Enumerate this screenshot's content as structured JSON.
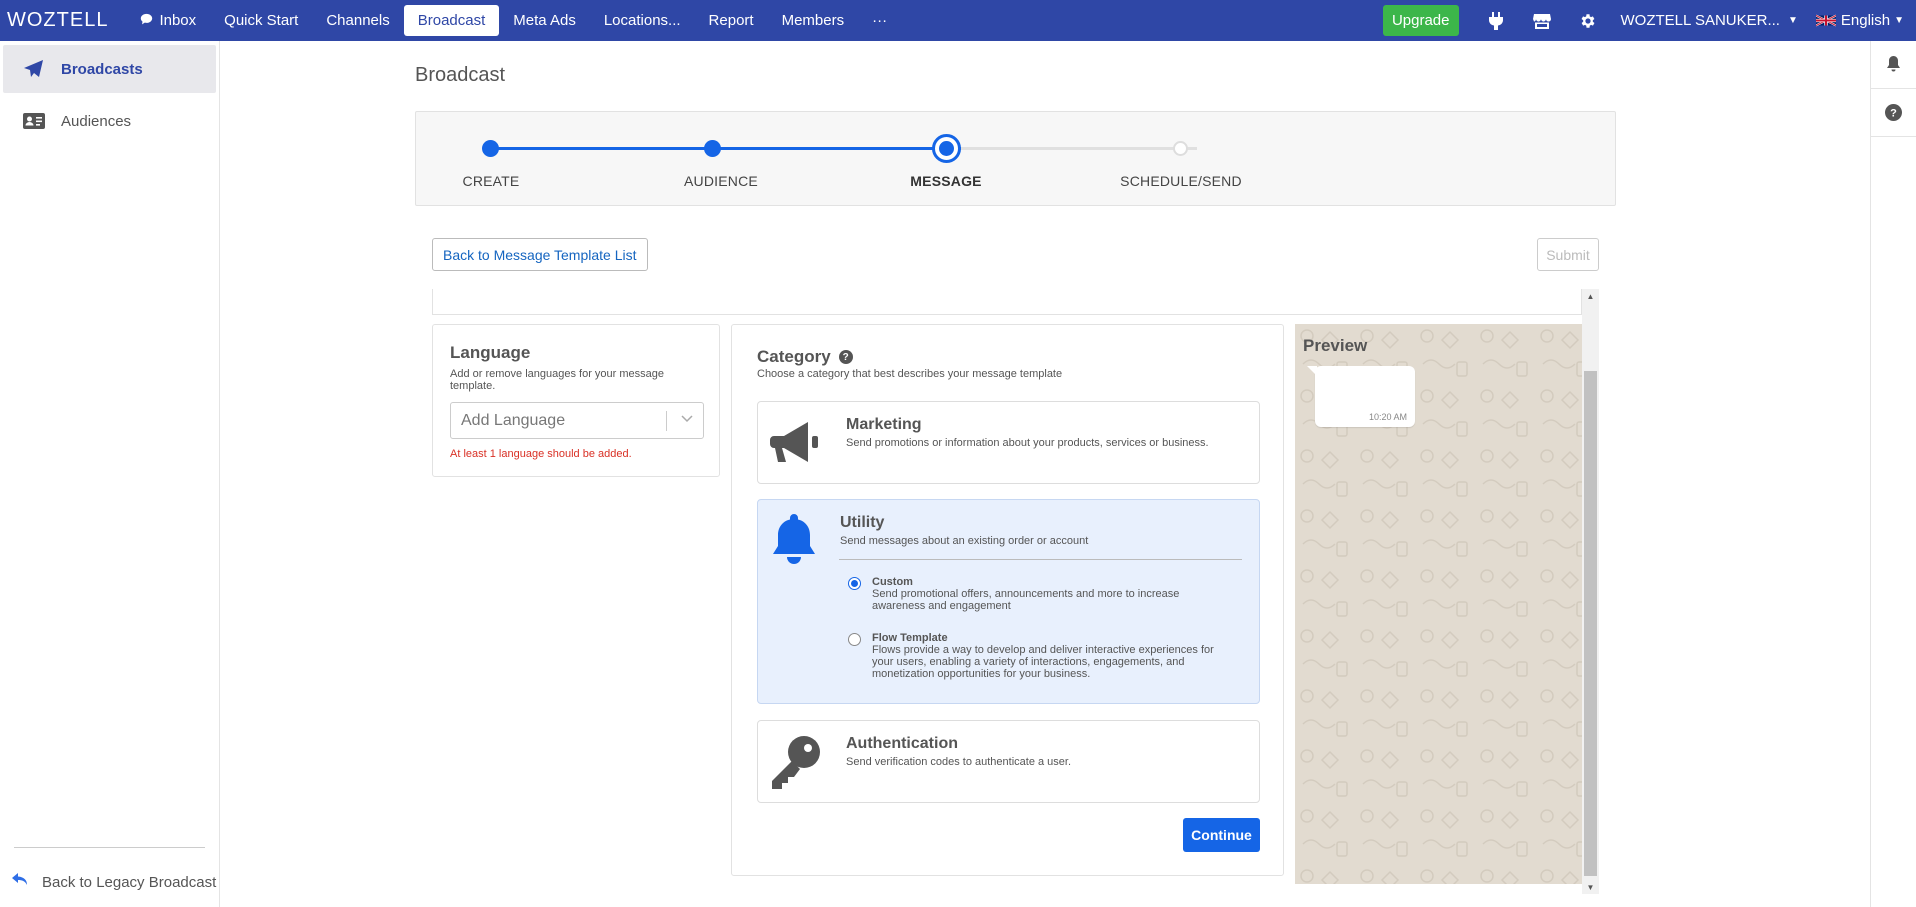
{
  "nav": {
    "logo": "WOZTELL",
    "items": [
      {
        "label": "Inbox",
        "icon": "chat-bubble-icon"
      },
      {
        "label": "Quick Start"
      },
      {
        "label": "Channels"
      },
      {
        "label": "Broadcast",
        "active": true
      },
      {
        "label": "Meta Ads"
      },
      {
        "label": "Locations..."
      },
      {
        "label": "Report"
      },
      {
        "label": "Members"
      },
      {
        "label": "···"
      }
    ],
    "upgrade": "Upgrade",
    "account": "WOZTELL SANUKER...",
    "language": "English",
    "colors": {
      "bar": "#2f47a6",
      "upgrade": "#3cb64a"
    }
  },
  "sidebar": {
    "items": [
      {
        "label": "Broadcasts",
        "icon": "paper-plane-icon",
        "active": true
      },
      {
        "label": "Audiences",
        "icon": "id-card-icon"
      }
    ],
    "legacy": "Back to Legacy Broadcast"
  },
  "page": {
    "title": "Broadcast"
  },
  "stepper": {
    "steps": [
      "CREATE",
      "AUDIENCE",
      "MESSAGE",
      "SCHEDULE/SEND"
    ],
    "current_index": 2
  },
  "buttons": {
    "back": "Back to Message Template List",
    "submit": "Submit",
    "continue": "Continue"
  },
  "language": {
    "title": "Language",
    "subtitle": "Add or remove languages for your message template.",
    "placeholder": "Add Language",
    "error": "At least 1 language should be added."
  },
  "category": {
    "title": "Category",
    "subtitle": "Choose a category that best describes your message template",
    "options": [
      {
        "title": "Marketing",
        "desc": "Send promotions or information about your products, services or business.",
        "icon": "megaphone-icon"
      },
      {
        "title": "Utility",
        "desc": "Send messages about an existing order or account",
        "icon": "bell-icon",
        "selected": true,
        "sub": [
          {
            "title": "Custom",
            "desc": "Send promotional offers, announcements and more to increase awareness and engagement",
            "checked": true
          },
          {
            "title": "Flow Template",
            "desc": "Flows provide a way to develop and deliver interactive experiences for your users, enabling a variety of interactions, engagements, and monetization opportunities for your business.",
            "checked": false
          }
        ]
      },
      {
        "title": "Authentication",
        "desc": "Send verification codes to authenticate a user.",
        "icon": "key-icon"
      }
    ]
  },
  "preview": {
    "title": "Preview",
    "time": "10:20 AM"
  }
}
